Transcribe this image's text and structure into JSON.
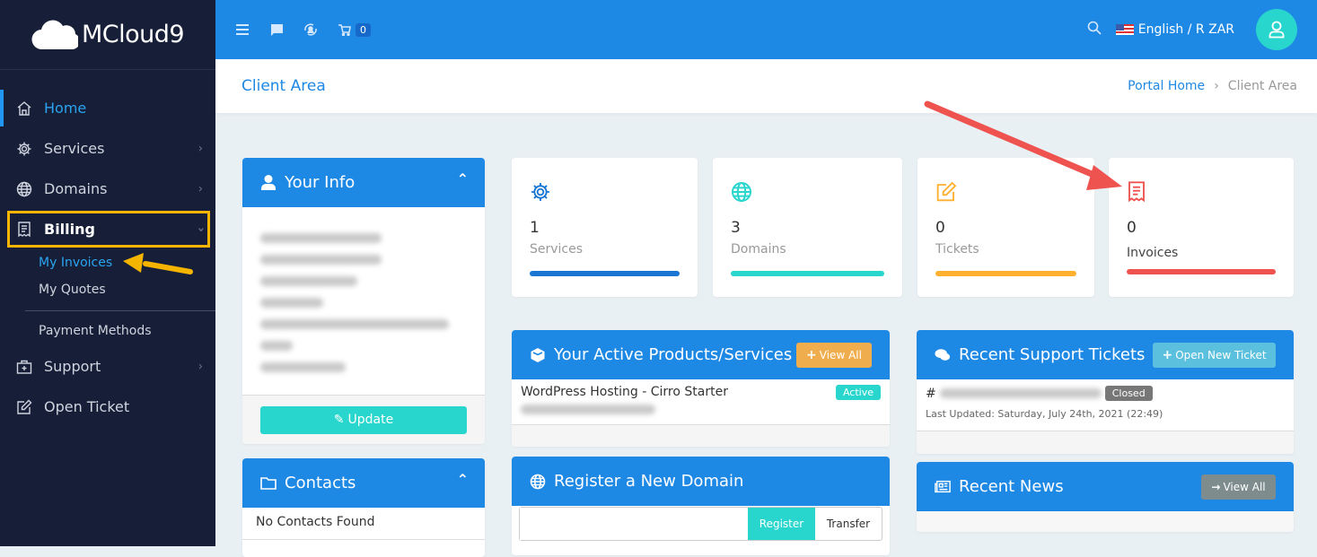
{
  "brand": {
    "name": "MCloud9"
  },
  "sidebar": {
    "items": [
      {
        "label": "Home",
        "icon": "home-icon",
        "active": true
      },
      {
        "label": "Services",
        "icon": "gear-icon"
      },
      {
        "label": "Domains",
        "icon": "globe-icon"
      },
      {
        "label": "Billing",
        "icon": "receipt-icon",
        "expanded": true
      }
    ],
    "billing_sub": [
      {
        "label": "My Invoices",
        "active": true
      },
      {
        "label": "My Quotes"
      },
      {
        "label": "Payment Methods"
      }
    ],
    "items_after": [
      {
        "label": "Support",
        "icon": "briefcase-plus-icon"
      },
      {
        "label": "Open Ticket",
        "icon": "edit-icon"
      }
    ]
  },
  "topbar": {
    "cart_count": "0",
    "language": "English / R ZAR"
  },
  "page": {
    "title": "Client Area",
    "breadcrumb": [
      "Portal Home",
      "Client Area"
    ]
  },
  "your_info": {
    "title": "Your Info",
    "update_label": "Update"
  },
  "stats": [
    {
      "count": "1",
      "label": "Services",
      "color": "#1976d2"
    },
    {
      "count": "3",
      "label": "Domains",
      "color": "#29d6cd"
    },
    {
      "count": "0",
      "label": "Tickets",
      "color": "#ffb02e"
    },
    {
      "count": "0",
      "label": "Invoices",
      "color": "#ef5350"
    }
  ],
  "products": {
    "title": "Your Active Products/Services",
    "view_all": "View All",
    "items": [
      {
        "name": "WordPress Hosting - Cirro Starter",
        "status": "Active"
      }
    ]
  },
  "tickets": {
    "title": "Recent Support Tickets",
    "open_new": "Open New Ticket",
    "items": [
      {
        "prefix": "#",
        "status": "Closed",
        "updated": "Last Updated: Saturday, July 24th, 2021 (22:49)"
      }
    ]
  },
  "contacts": {
    "title": "Contacts",
    "empty": "No Contacts Found"
  },
  "domain_register": {
    "title": "Register a New Domain",
    "input_value": "",
    "register_label": "Register",
    "transfer_label": "Transfer"
  },
  "news": {
    "title": "Recent News",
    "view_all": "View All"
  },
  "colors": {
    "primary": "#1e88e5",
    "sidebar_bg": "#171f38",
    "teal": "#29d6cd",
    "highlight": "#f4b400",
    "annotation_arrow": "#ef5350"
  }
}
